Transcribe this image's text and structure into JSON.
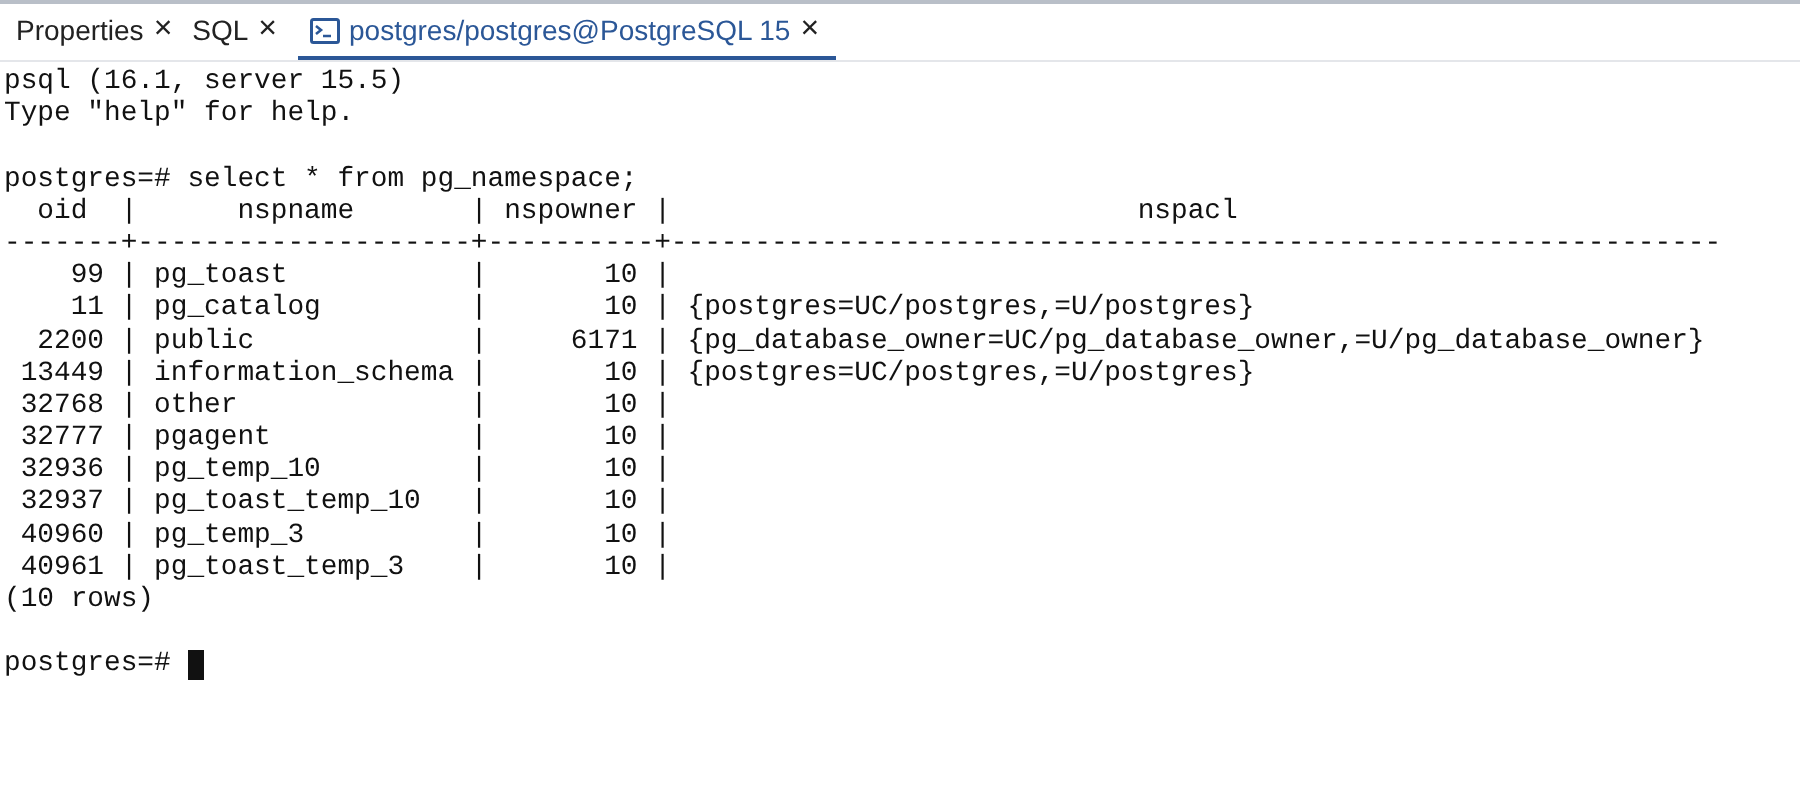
{
  "tabs": [
    {
      "label": "Properties",
      "close": "×",
      "selected": false,
      "kind": "plain"
    },
    {
      "label": "SQL",
      "close": "×",
      "selected": false,
      "kind": "plain"
    },
    {
      "label": "postgres/postgres@PostgreSQL 15",
      "close": "×",
      "selected": true,
      "kind": "terminal"
    }
  ],
  "terminal": {
    "blocks": [
      {
        "lines": [
          "psql (16.1, server 15.5)",
          "Type \"help\" for help."
        ]
      },
      {
        "lines": [
          "postgres=# select * from pg_namespace;",
          "  oid  |      nspname       | nspowner |                            nspacl",
          "-------+--------------------+----------+---------------------------------------------------------------",
          "    99 | pg_toast           |       10 |",
          "    11 | pg_catalog         |       10 | {postgres=UC/postgres,=U/postgres}",
          "  2200 | public             |     6171 | {pg_database_owner=UC/pg_database_owner,=U/pg_database_owner}",
          " 13449 | information_schema |       10 | {postgres=UC/postgres,=U/postgres}",
          " 32768 | other              |       10 |",
          " 32777 | pgagent            |       10 |",
          " 32936 | pg_temp_10         |       10 |",
          " 32937 | pg_toast_temp_10   |       10 |",
          " 40960 | pg_temp_3          |       10 |",
          " 40961 | pg_toast_temp_3    |       10 |",
          "(10 rows)"
        ]
      }
    ],
    "prompt": "postgres=# "
  }
}
